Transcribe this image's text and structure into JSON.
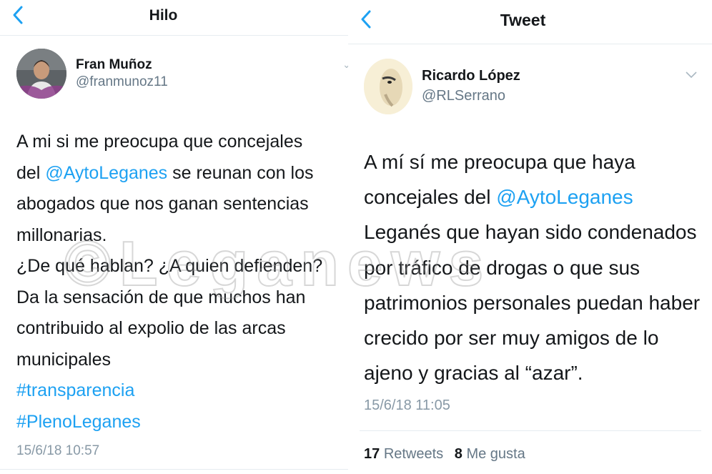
{
  "left": {
    "nav_title": "Hilo",
    "author_name": "Fran Muñoz",
    "author_handle": "@franmunoz11",
    "text_lines": [
      [
        {
          "t": "A mi si me preocupa que concejales"
        }
      ],
      [
        {
          "t": "del "
        },
        {
          "t": "@AytoLeganes",
          "k": "mention"
        },
        {
          "t": " se reunan con los"
        }
      ],
      [
        {
          "t": "abogados que nos ganan sentencias"
        }
      ],
      [
        {
          "t": "millonarias."
        }
      ],
      [
        {
          "t": "¿De qué hablan? ¿A quien defienden?"
        }
      ],
      [
        {
          "t": "Da la sensación de que muchos han"
        }
      ],
      [
        {
          "t": "contribuido al expolio de las arcas"
        }
      ],
      [
        {
          "t": "municipales"
        }
      ],
      [
        {
          "t": "#transparencia",
          "k": "hashtag"
        }
      ],
      [
        {
          "t": "#PlenoLeganes",
          "k": "hashtag"
        }
      ]
    ],
    "timestamp": "15/6/18 10:57"
  },
  "right": {
    "nav_title": "Tweet",
    "author_name": "Ricardo López",
    "author_handle": "@RLSerrano",
    "text_lines": [
      [
        {
          "t": "A mí sí me preocupa que haya"
        }
      ],
      [
        {
          "t": "concejales del "
        },
        {
          "t": "@AytoLeganes",
          "k": "mention"
        }
      ],
      [
        {
          "t": "Leganés que hayan sido condenados"
        }
      ],
      [
        {
          "t": "por tráfico de drogas o que sus"
        }
      ],
      [
        {
          "t": "patrimonios personales puedan haber"
        }
      ],
      [
        {
          "t": "crecido por ser muy amigos de lo"
        }
      ],
      [
        {
          "t": "ajeno y gracias al “azar”."
        }
      ]
    ],
    "timestamp": "15/6/18 11:05",
    "retweets_count": "17",
    "retweets_label": "Retweets",
    "likes_count": "8",
    "likes_label": "Me gusta"
  },
  "watermark": "©Leganews",
  "colors": {
    "accent": "#1da1f2",
    "text": "#14171a",
    "secondary": "#657786",
    "divider": "#e6ecf0"
  },
  "icons": {
    "back": "chevron-left-icon",
    "menu": "chevron-down-icon"
  }
}
